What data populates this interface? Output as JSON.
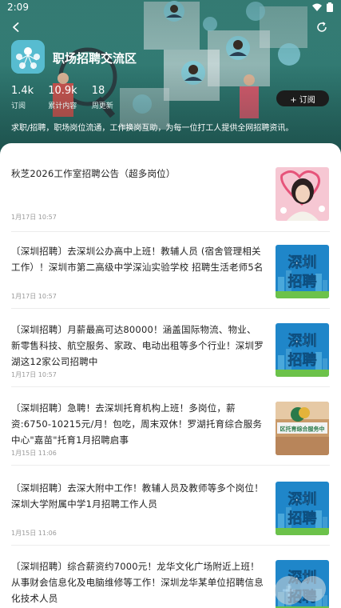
{
  "status_bar": {
    "time": "2:09"
  },
  "forum": {
    "title": "职场招聘交流区",
    "description": "求职/招聘，职场岗位流通，工作换岗互助，为每一位打工人提供全网招聘资讯。",
    "subscribe_label": "+ 订阅",
    "stats": [
      {
        "value": "1.4k",
        "label": "订阅"
      },
      {
        "value": "10.9k",
        "label": "累计内容"
      },
      {
        "value": "18",
        "label": "周更新"
      }
    ]
  },
  "posts": [
    {
      "title": "秋芝2026工作室招聘公告（超多岗位）",
      "time": "1月17日 10:57",
      "thumb": "portrait-icon"
    },
    {
      "title": "〔深圳招聘〕去深圳公办高中上班！教辅人员 (宿舍管理相关工作）！深圳市第二高级中学深汕实验学校 招聘生活老师5名",
      "time": "1月17日 10:57",
      "thumb": "shenzhen-recruit-icon",
      "thumb_text": [
        "深圳",
        "招聘"
      ]
    },
    {
      "title": "〔深圳招聘〕月薪最高可达80000！涵盖国际物流、物业、新零售科技、航空服务、家政、电动出租等多个行业！深圳罗湖这12家公司招聘中",
      "time": "1月17日 10:57",
      "thumb": "shenzhen-recruit-icon",
      "thumb_text": [
        "深圳",
        "招聘"
      ]
    },
    {
      "title": "〔深圳招聘〕急聘！去深圳托育机构上班！多岗位，薪资:6750-10215元/月！包吃，周末双休！罗湖托育综合服务中心\"嘉苗\"托育1月招聘启事",
      "time": "1月15日 11:06",
      "thumb": "nursery-sign-icon",
      "thumb_text": [
        "区托育综合服务中"
      ]
    },
    {
      "title": "〔深圳招聘〕去深大附中工作！教辅人员及教师等多个岗位！深圳大学附属中学1月招聘工作人员",
      "time": "1月15日 11:06",
      "thumb": "shenzhen-recruit-icon",
      "thumb_text": [
        "深圳",
        "招聘"
      ]
    },
    {
      "title": "〔深圳招聘〕综合薪资约7000元！龙华文化广场附近上班！从事财会信息化及电脑维修等工作！深圳龙华某单位招聘信息化技术人员",
      "time": "",
      "thumb": "shenzhen-recruit-icon",
      "thumb_text": [
        "深圳",
        "招聘"
      ]
    }
  ],
  "colors": {
    "header": "#2f7770",
    "subscribe_bg": "#1c1c1c",
    "thumb_blue": "#1f86c9",
    "thumb_text": "#ffffff"
  }
}
